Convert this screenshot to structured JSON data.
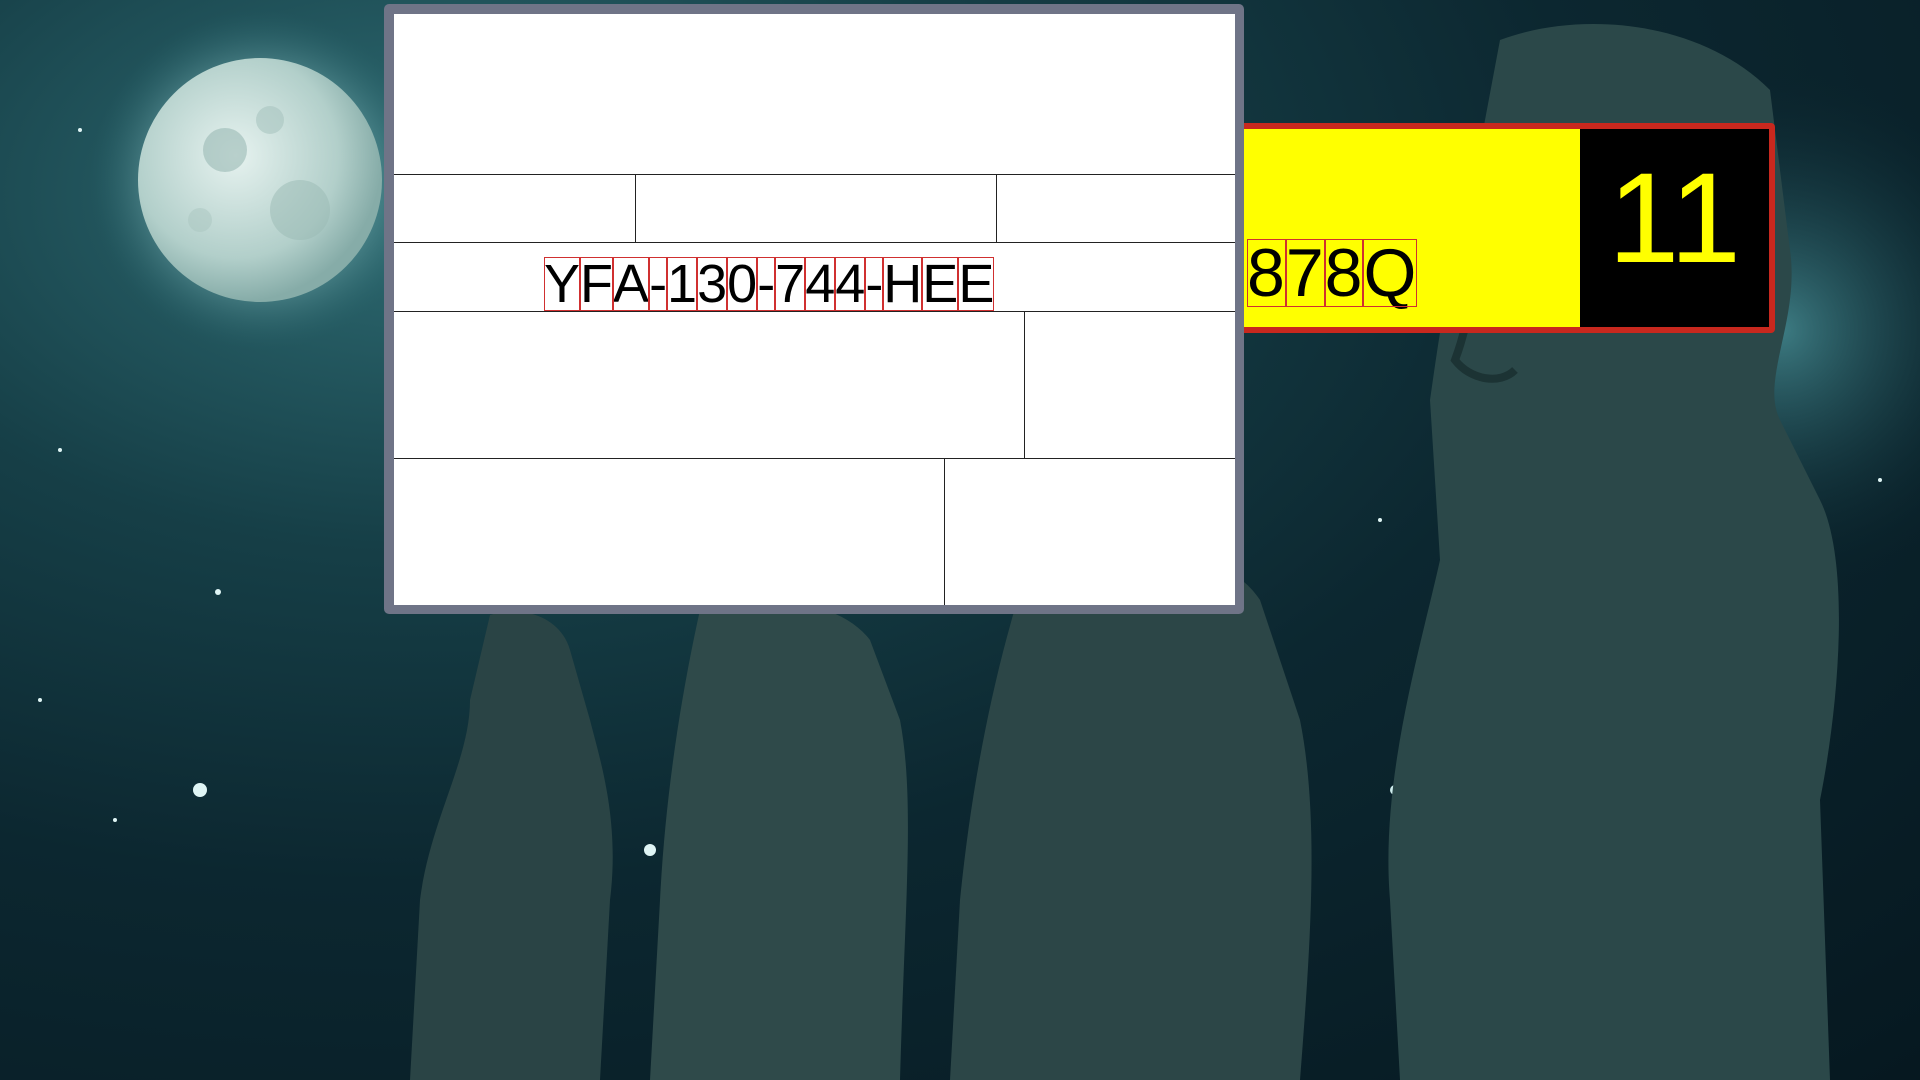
{
  "serial_field": {
    "chars": [
      "Y",
      "F",
      "A",
      "-",
      "1",
      "3",
      "0",
      "-",
      "7",
      "4",
      "4",
      "-",
      "H",
      "E",
      "E"
    ]
  },
  "side_panel": {
    "code_chars": [
      "8",
      "7",
      "8",
      "Q"
    ],
    "number": "11",
    "colors": {
      "left_bg": "#ffff00",
      "right_bg": "#000000",
      "number_color": "#ffff00",
      "border": "#c8281e"
    }
  },
  "window": {
    "frame_color": "#6f7487",
    "background": "#ffffff"
  }
}
